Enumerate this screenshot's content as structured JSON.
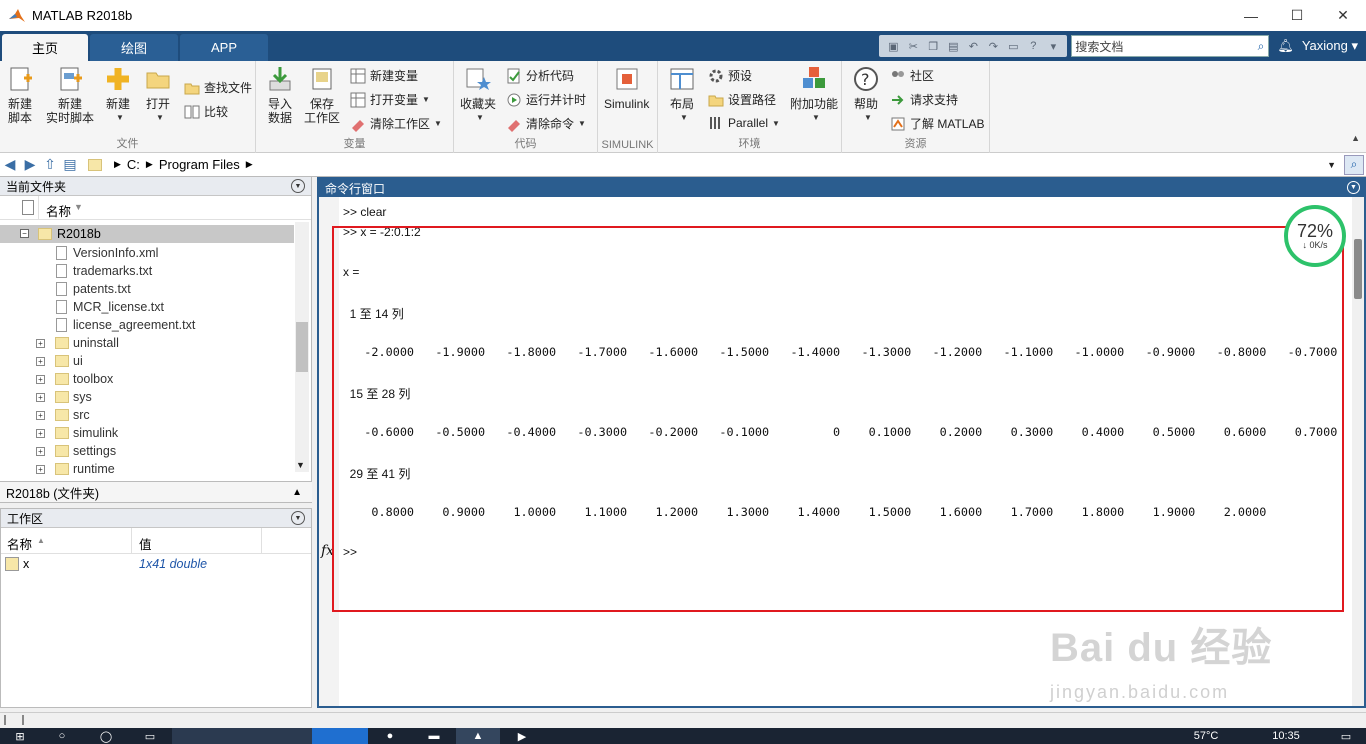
{
  "window": {
    "title": "MATLAB R2018b",
    "controls": [
      "—",
      "☐",
      "✕"
    ]
  },
  "tabs": [
    "主页",
    "绘图",
    "APP"
  ],
  "search": {
    "placeholder": "搜索文档"
  },
  "user": "Yaxiong",
  "ribbon": {
    "file": {
      "label": "文件",
      "new_script": [
        "新建",
        "脚本"
      ],
      "new_live_script": [
        "新建",
        "实时脚本"
      ],
      "new": "新建",
      "open": "打开",
      "find_files": "查找文件",
      "compare": "比较"
    },
    "variable": {
      "label": "变量",
      "import": [
        "导入",
        "数据"
      ],
      "save": [
        "保存",
        "工作区"
      ],
      "new_var": "新建变量",
      "open_var": "打开变量",
      "clear_ws": "清除工作区"
    },
    "code": {
      "label": "代码",
      "favorites": "收藏夹",
      "analyze": "分析代码",
      "run_time": "运行并计时",
      "clear_cmd": "清除命令"
    },
    "simulink": {
      "label": "SIMULINK",
      "button": "Simulink"
    },
    "environment": {
      "label": "环境",
      "layout": "布局",
      "prefs": "预设",
      "set_path": "设置路径",
      "parallel": "Parallel",
      "addons": "附加功能"
    },
    "resources": {
      "label": "资源",
      "help": "帮助",
      "community": "社区",
      "support": "请求支持",
      "learn": "了解 MATLAB"
    }
  },
  "address": {
    "drive": "C:",
    "folder": "Program Files"
  },
  "current_folder": {
    "title": "当前文件夹",
    "col_name": "名称",
    "root": "R2018b",
    "files": [
      "VersionInfo.xml",
      "trademarks.txt",
      "patents.txt",
      "MCR_license.txt",
      "license_agreement.txt"
    ],
    "folders": [
      "uninstall",
      "ui",
      "toolbox",
      "sys",
      "src",
      "simulink",
      "settings",
      "runtime"
    ],
    "status": "R2018b  (文件夹)"
  },
  "workspace": {
    "title": "工作区",
    "col_name": "名称",
    "col_value": "值",
    "vars": [
      {
        "name": "x",
        "value": "1x41 double"
      }
    ]
  },
  "command_window": {
    "title": "命令行窗口",
    "lines": [
      ">> clear",
      ">> x = -2:0.1:2",
      "x =",
      "  1 至 14 列",
      "   -2.0000   -1.9000   -1.8000   -1.7000   -1.6000   -1.5000   -1.4000   -1.3000   -1.2000   -1.1000   -1.0000   -0.9000   -0.8000   -0.7000",
      "  15 至 28 列",
      "   -0.6000   -0.5000   -0.4000   -0.3000   -0.2000   -0.1000         0    0.1000    0.2000    0.3000    0.4000    0.5000    0.6000    0.7000",
      "  29 至 41 列",
      "    0.8000    0.9000    1.0000    1.1000    1.2000    1.3000    1.4000    1.5000    1.6000    1.7000    1.8000    1.9000    2.0000",
      ">>"
    ],
    "fx": "fx"
  },
  "speed_widget": {
    "percent": "72%",
    "rate": "0K/s"
  },
  "watermark": {
    "brand": "Bai du 经验",
    "url": "jingyan.baidu.com"
  },
  "taskbar": {
    "temp": "57°C",
    "time": "10:35"
  },
  "colors": {
    "ribbon_blue": "#1e4c7c",
    "highlight_red": "#e0191f",
    "speed_green": "#2dc26a"
  }
}
